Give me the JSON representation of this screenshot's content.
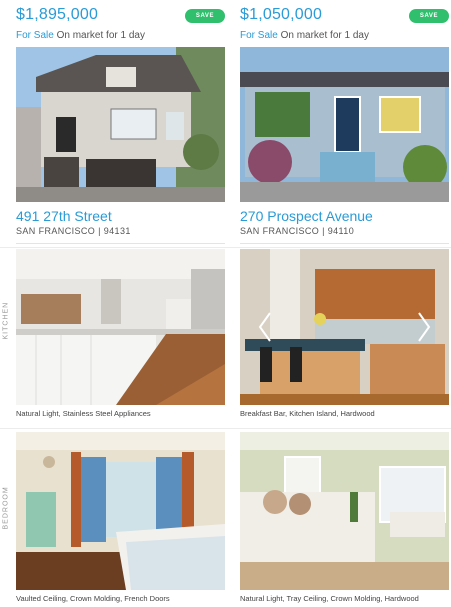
{
  "listings": [
    {
      "price": "$1,895,000",
      "save_label": "SAVE",
      "status_sale": "For Sale",
      "status_market": "On market for 1 day",
      "address": "491 27th Street",
      "city_zip": "SAN FRANCISCO | 94131",
      "kitchen_caption": "Natural Light, Stainless Steel Appliances",
      "bedroom_caption": "Vaulted Ceiling, Crown Molding, French Doors"
    },
    {
      "price": "$1,050,000",
      "save_label": "SAVE",
      "status_sale": "For Sale",
      "status_market": "On market for 1 day",
      "address": "270 Prospect Avenue",
      "city_zip": "SAN FRANCISCO | 94110",
      "kitchen_caption": "Breakfast Bar, Kitchen Island, Hardwood",
      "bedroom_caption": "Natural Light, Tray Ceiling, Crown Molding, Hardwood"
    }
  ],
  "rooms": {
    "kitchen": "KITCHEN",
    "bedroom": "BEDROOM"
  },
  "colors": {
    "accent": "#2a9bd6",
    "save_button": "#2fbf6d"
  }
}
